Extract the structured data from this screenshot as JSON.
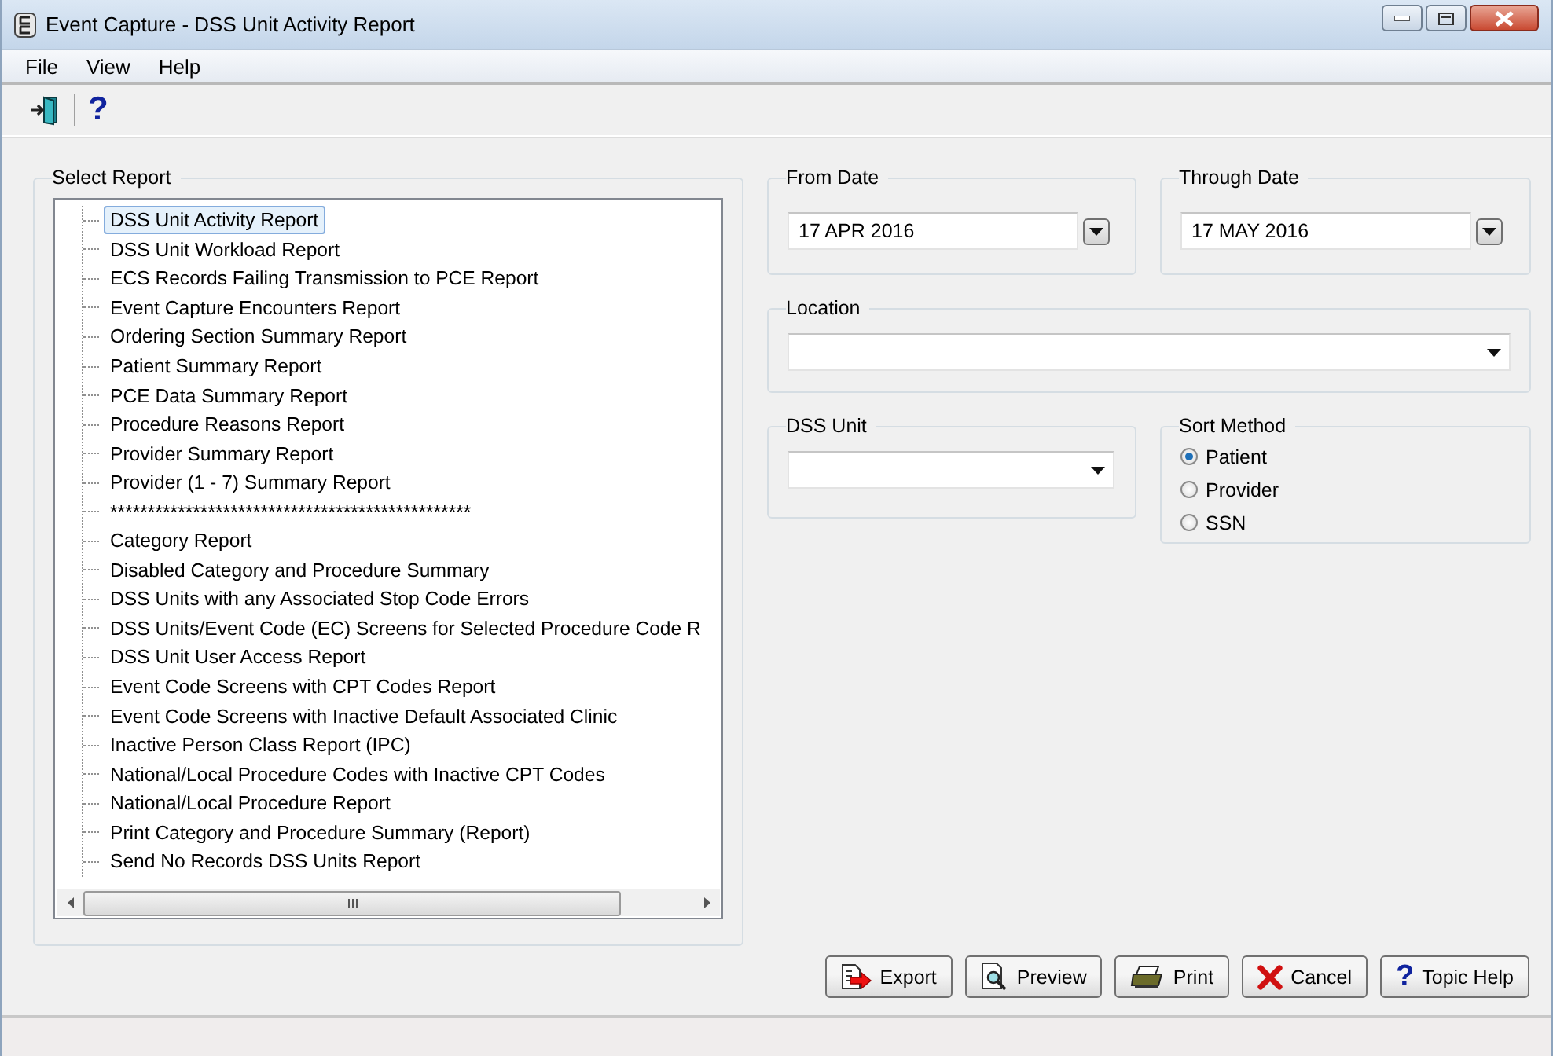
{
  "window": {
    "title": "Event Capture - DSS Unit Activity Report"
  },
  "menu": [
    {
      "label": "File"
    },
    {
      "label": "View"
    },
    {
      "label": "Help"
    }
  ],
  "toolbar": {
    "help_icon": "?"
  },
  "select_report": {
    "label": "Select Report",
    "items": [
      {
        "label": "DSS Unit Activity Report",
        "selected": true
      },
      {
        "label": "DSS Unit Workload Report",
        "selected": false
      },
      {
        "label": "ECS Records Failing Transmission to PCE Report",
        "selected": false
      },
      {
        "label": "Event Capture Encounters Report",
        "selected": false
      },
      {
        "label": "Ordering Section Summary Report",
        "selected": false
      },
      {
        "label": "Patient Summary Report",
        "selected": false
      },
      {
        "label": "PCE Data Summary Report",
        "selected": false
      },
      {
        "label": "Procedure Reasons Report",
        "selected": false
      },
      {
        "label": "Provider Summary Report",
        "selected": false
      },
      {
        "label": "Provider (1 - 7) Summary Report",
        "selected": false
      },
      {
        "label": "************************************************",
        "selected": false
      },
      {
        "label": "Category Report",
        "selected": false
      },
      {
        "label": "Disabled Category and Procedure Summary",
        "selected": false
      },
      {
        "label": "DSS Units with any Associated Stop Code Errors",
        "selected": false
      },
      {
        "label": "DSS Units/Event Code (EC) Screens for Selected Procedure Code R",
        "selected": false
      },
      {
        "label": "DSS Unit User Access Report",
        "selected": false
      },
      {
        "label": "Event Code Screens with CPT Codes Report",
        "selected": false
      },
      {
        "label": "Event Code Screens with Inactive Default Associated Clinic",
        "selected": false
      },
      {
        "label": "Inactive Person Class Report (IPC)",
        "selected": false
      },
      {
        "label": "National/Local Procedure Codes with Inactive CPT Codes",
        "selected": false
      },
      {
        "label": "National/Local Procedure Report",
        "selected": false
      },
      {
        "label": "Print Category and Procedure Summary (Report)",
        "selected": false
      },
      {
        "label": "Send No Records DSS Units Report",
        "selected": false
      }
    ]
  },
  "from_date": {
    "label": "From Date",
    "value": "17 APR 2016"
  },
  "through_date": {
    "label": "Through Date",
    "value": "17 MAY 2016"
  },
  "location": {
    "label": "Location"
  },
  "dss_unit": {
    "label": "DSS Unit"
  },
  "sort_method": {
    "label": "Sort Method",
    "options": [
      {
        "label": "Patient",
        "selected": true
      },
      {
        "label": "Provider",
        "selected": false
      },
      {
        "label": "SSN",
        "selected": false
      }
    ]
  },
  "buttons": [
    {
      "kind": "export",
      "label": "Export"
    },
    {
      "kind": "preview",
      "label": "Preview"
    },
    {
      "kind": "print",
      "label": "Print"
    },
    {
      "kind": "cancel",
      "label": "Cancel"
    },
    {
      "kind": "help",
      "label": "Topic Help",
      "icon": "?"
    }
  ]
}
